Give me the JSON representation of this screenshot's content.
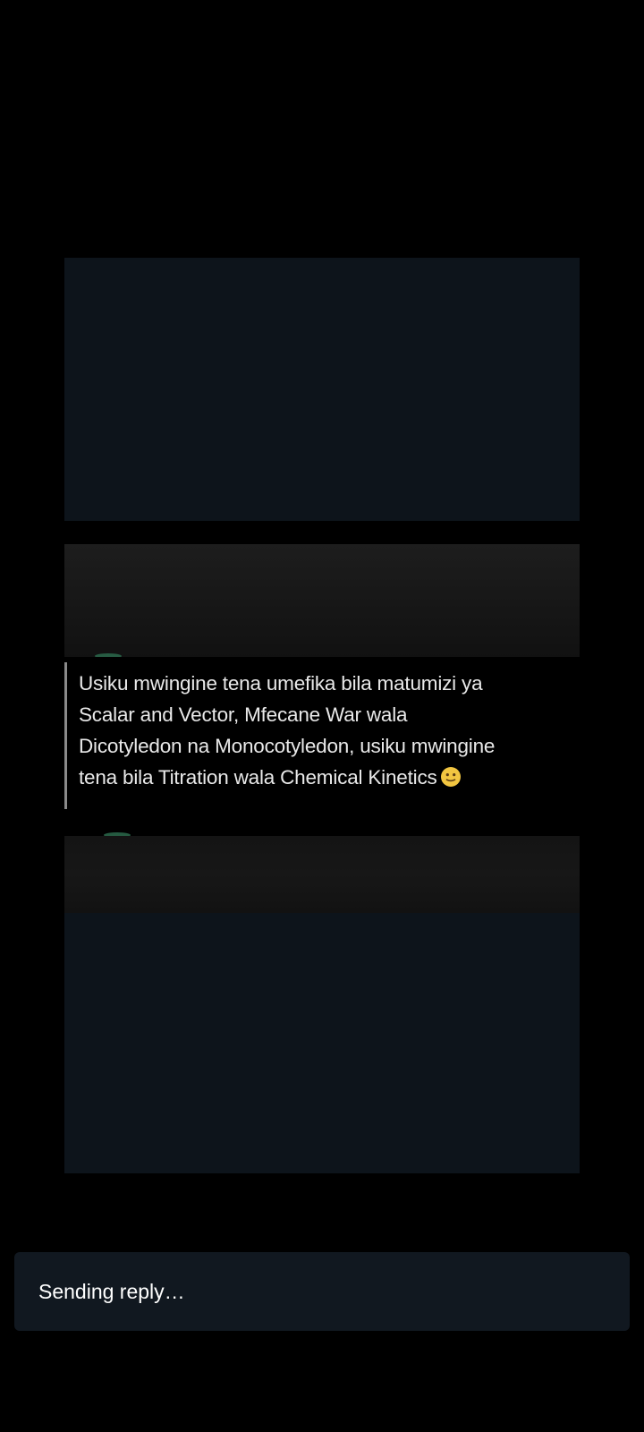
{
  "status_post": {
    "quoted_text": "Usiku mwingine tena umefika bila matumizi ya\nScalar and Vector, Mfecane War wala\nDicotyledon na Monocotyledon, usiku mwingine\ntena bila Titration wala Chemical Kinetics",
    "emoji_icon": "slightly-smiling-face-emoji"
  },
  "snackbar": {
    "message": "Sending reply…"
  },
  "colors": {
    "background": "#000000",
    "panel": "#0d141b",
    "snackbar": "#111820",
    "text": "#e9e9e9"
  }
}
